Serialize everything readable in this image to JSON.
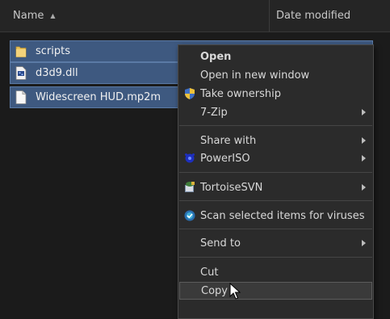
{
  "header": {
    "name_label": "Name",
    "date_label": "Date modified"
  },
  "files": [
    {
      "name": "scripts",
      "icon": "folder-icon"
    },
    {
      "name": "d3d9.dll",
      "icon": "dll-file-icon"
    },
    {
      "name": "Widescreen HUD.mp2m",
      "icon": "blank-file-icon"
    }
  ],
  "context_menu": {
    "open": "Open",
    "open_new_window": "Open in new window",
    "take_ownership": "Take ownership",
    "seven_zip": "7-Zip",
    "share_with": "Share with",
    "poweriso": "PowerISO",
    "tortoisesvn": "TortoiseSVN",
    "scan": "Scan selected items for viruses",
    "send_to": "Send to",
    "cut": "Cut",
    "copy": "Copy"
  },
  "colors": {
    "selection": "#3e5980",
    "menu_bg": "#2b2b2b",
    "background": "#1b1b1b"
  }
}
